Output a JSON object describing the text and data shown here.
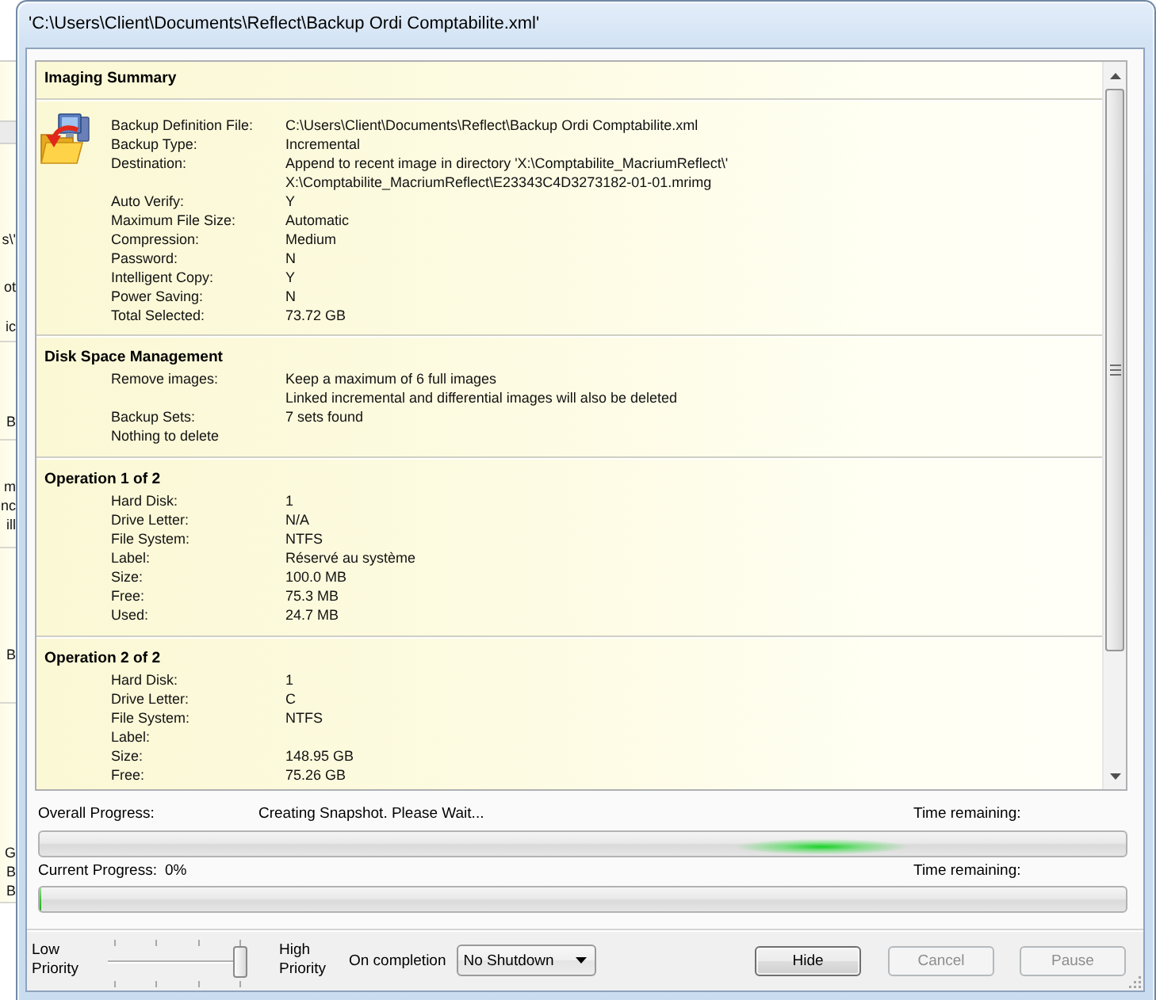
{
  "window": {
    "title": "'C:\\Users\\Client\\Documents\\Reflect\\Backup Ordi Comptabilite.xml'"
  },
  "background_window": {
    "fragments": [
      "s\\'",
      "ot",
      "ic",
      "B",
      "m",
      "nc",
      "ill",
      "B",
      "G",
      "B",
      "B"
    ]
  },
  "summary": {
    "sections": [
      {
        "kind": "header",
        "title": "Imaging Summary",
        "rows": [
          {
            "label": "Backup Definition File:",
            "value": "C:\\Users\\Client\\Documents\\Reflect\\Backup Ordi Comptabilite.xml"
          },
          {
            "label": "Backup Type:",
            "value": "Incremental"
          },
          {
            "label": "Destination:",
            "value": "Append to recent image in directory 'X:\\Comptabilite_MacriumReflect\\'"
          },
          {
            "value": "X:\\Comptabilite_MacriumReflect\\E23343C4D3273182-01-01.mrimg"
          },
          {
            "label": "Auto Verify:",
            "value": "Y"
          },
          {
            "label": "Maximum File Size:",
            "value": "Automatic"
          },
          {
            "label": "Compression:",
            "value": "Medium"
          },
          {
            "label": "Password:",
            "value": "N"
          },
          {
            "label": "Intelligent Copy:",
            "value": "Y"
          },
          {
            "label": "Power Saving:",
            "value": "N"
          },
          {
            "label": "Total Selected:",
            "value": "73.72 GB"
          }
        ]
      },
      {
        "kind": "group",
        "title": "Disk Space Management",
        "rows": [
          {
            "label": "Remove images:",
            "value": "Keep a maximum of 6 full images"
          },
          {
            "value": "Linked incremental and differential images will also be deleted"
          },
          {
            "label": "Backup Sets:",
            "value": "7 sets found"
          },
          {
            "label": "Nothing to delete"
          }
        ]
      },
      {
        "kind": "group",
        "title": "Operation 1 of 2",
        "rows": [
          {
            "label": "Hard Disk:",
            "value": "1"
          },
          {
            "label": "Drive Letter:",
            "value": "N/A"
          },
          {
            "label": "File System:",
            "value": "NTFS"
          },
          {
            "label": "Label:",
            "value": "Réservé au système"
          },
          {
            "label": "Size:",
            "value": "100.0 MB"
          },
          {
            "label": "Free:",
            "value": "75.3 MB"
          },
          {
            "label": "Used:",
            "value": "24.7 MB"
          }
        ]
      },
      {
        "kind": "group",
        "title": "Operation 2 of 2",
        "rows": [
          {
            "label": "Hard Disk:",
            "value": "1"
          },
          {
            "label": "Drive Letter:",
            "value": "C"
          },
          {
            "label": "File System:",
            "value": "NTFS"
          },
          {
            "label": "Label:"
          },
          {
            "label": "Size:",
            "value": "148.95 GB"
          },
          {
            "label": "Free:",
            "value": "75.26 GB"
          }
        ]
      }
    ]
  },
  "progress": {
    "bars": [
      {
        "kind": "marquee",
        "label": "Overall Progress:",
        "status": "Creating Snapshot. Please Wait...",
        "time_label": "Time remaining:"
      },
      {
        "kind": "level",
        "label": "Current Progress:",
        "percent": "0%",
        "time_label": "Time remaining:",
        "level": 0
      }
    ]
  },
  "footer": {
    "priority": {
      "low_label": "Low Priority",
      "high_label": "High Priority",
      "level": 1
    },
    "completion": {
      "label": "On completion",
      "value": "No Shutdown"
    },
    "buttons": [
      {
        "label": "Hide",
        "disabled": false
      },
      {
        "label": "Cancel",
        "disabled": true
      },
      {
        "label": "Pause",
        "disabled": true
      }
    ]
  }
}
